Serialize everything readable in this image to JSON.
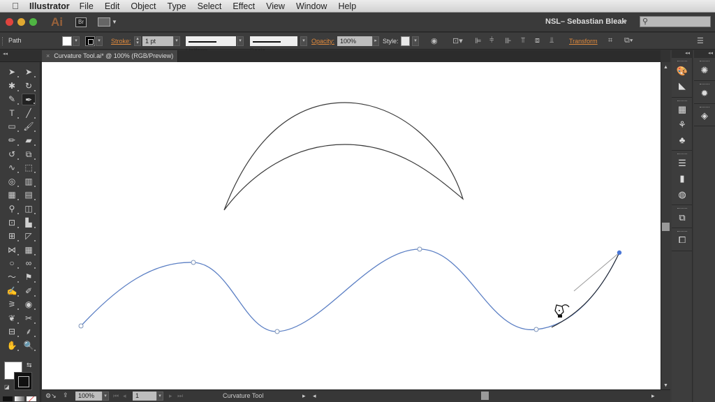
{
  "menubar": {
    "apple_icon": "",
    "app_name": "Illustrator",
    "items": [
      "File",
      "Edit",
      "Object",
      "Type",
      "Select",
      "Effect",
      "View",
      "Window",
      "Help"
    ]
  },
  "appbar": {
    "logo": "Ai",
    "bridge": "Br",
    "workspace": "NSL– Sebastian Bleak",
    "workspace_caret": "▾",
    "search_placeholder": ""
  },
  "control": {
    "selection_label": "Path",
    "stroke_label": "Stroke:",
    "stroke_weight": "1 pt",
    "variable_width": "Uniform",
    "brush": "Basic",
    "opacity_label": "Opacity:",
    "opacity_value": "100%",
    "style_label": "Style:",
    "transform_label": "Transform"
  },
  "document": {
    "tab_title": "Curvature Tool.ai* @ 100% (RGB/Preview)",
    "close": "×"
  },
  "status": {
    "zoom": "100%",
    "artboard": "1",
    "current_tool": "Curvature Tool"
  },
  "colors": {
    "path_selected": "#4f78c8",
    "anchor_active": "#4a77d6",
    "accent_label": "#e08a3c"
  },
  "tools": [
    {
      "name": "selection-tool",
      "glyph": "➤"
    },
    {
      "name": "direct-selection-tool",
      "glyph": "➤"
    },
    {
      "name": "magic-wand-tool",
      "glyph": "✱"
    },
    {
      "name": "lasso-tool",
      "glyph": "↻"
    },
    {
      "name": "pen-tool",
      "glyph": "✎"
    },
    {
      "name": "curvature-tool",
      "glyph": "✒"
    },
    {
      "name": "type-tool",
      "glyph": "T"
    },
    {
      "name": "line-segment-tool",
      "glyph": "╱"
    },
    {
      "name": "rectangle-tool",
      "glyph": "▭"
    },
    {
      "name": "paintbrush-tool",
      "glyph": "🖌"
    },
    {
      "name": "pencil-tool",
      "glyph": "✏"
    },
    {
      "name": "eraser-tool",
      "glyph": "▰"
    },
    {
      "name": "rotate-tool",
      "glyph": "↺"
    },
    {
      "name": "scale-tool",
      "glyph": "⧉"
    },
    {
      "name": "warp-tool",
      "glyph": "∿"
    },
    {
      "name": "free-transform-tool",
      "glyph": "⬚"
    },
    {
      "name": "shape-builder-tool",
      "glyph": "◎"
    },
    {
      "name": "perspective-grid-tool",
      "glyph": "▥"
    },
    {
      "name": "mesh-tool",
      "glyph": "▦"
    },
    {
      "name": "gradient-tool",
      "glyph": "▤"
    },
    {
      "name": "eyedropper-tool",
      "glyph": "⚲"
    },
    {
      "name": "blend-tool",
      "glyph": "◫"
    },
    {
      "name": "symbol-sprayer-tool",
      "glyph": "⊡"
    },
    {
      "name": "column-graph-tool",
      "glyph": "▙"
    },
    {
      "name": "artboard-tool",
      "glyph": "⊞"
    },
    {
      "name": "slice-tool",
      "glyph": "◸"
    },
    {
      "name": "width-tool",
      "glyph": "⋈"
    },
    {
      "name": "live-paint-bucket-tool",
      "glyph": "▦"
    },
    {
      "name": "ellipse-tool",
      "glyph": "○"
    },
    {
      "name": "shaper-tool",
      "glyph": "∞"
    },
    {
      "name": "smooth-tool",
      "glyph": "〜"
    },
    {
      "name": "blob-brush-tool",
      "glyph": "⚑"
    },
    {
      "name": "puppet-warp-tool",
      "glyph": "✍"
    },
    {
      "name": "reshape-tool",
      "glyph": "✐"
    },
    {
      "name": "crystallize-tool",
      "glyph": "⚞"
    },
    {
      "name": "twirl-tool",
      "glyph": "◉"
    },
    {
      "name": "feather-tool",
      "glyph": "❦"
    },
    {
      "name": "knife-tool",
      "glyph": "✂"
    },
    {
      "name": "crop-area-tool",
      "glyph": "⊟"
    },
    {
      "name": "scissors-tool",
      "glyph": "⸙"
    },
    {
      "name": "hand-tool",
      "glyph": "✋"
    },
    {
      "name": "zoom-tool",
      "glyph": "🔍"
    }
  ],
  "dock_panels": {
    "column1": [
      "color-panel",
      "color-guide-panel",
      "swatches-panel",
      "brushes-panel",
      "symbols-panel",
      "stroke-panel",
      "gradient-panel",
      "transparency-panel",
      "artboards-panel",
      "layers-stack-panel"
    ],
    "column2": [
      "appearance-panel",
      "graphic-styles-panel",
      "layers-panel"
    ]
  }
}
